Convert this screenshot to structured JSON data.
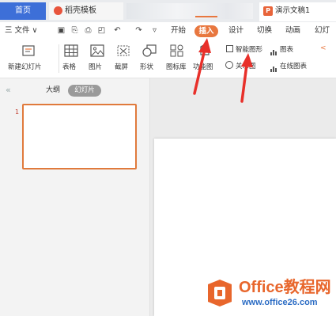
{
  "tabs": {
    "home": "首页",
    "template": "稻壳模板",
    "document": "演示文稿1"
  },
  "menu": {
    "file": "三 文件 ∨",
    "items": [
      "开始",
      "插入",
      "设计",
      "切换",
      "动画",
      "幻灯片"
    ]
  },
  "ribbon": {
    "new_slide": "新建幻灯片",
    "table": "表格",
    "image": "图片",
    "screenshot": "截屏",
    "shape": "形状",
    "icon_library": "图标库",
    "function_chart": "功能图",
    "smartart": "智能图形",
    "chart": "图表",
    "relation": "关系图",
    "online_chart": "在线图表"
  },
  "left_pane": {
    "outline_tab": "大纲",
    "slides_tab": "幻灯片",
    "slide_number": "1"
  },
  "watermark": {
    "title": "Office教程网",
    "url": "www.office26.com"
  },
  "colors": {
    "accent": "#e8773f",
    "home_tab": "#3d6fd8",
    "arrow": "#e8302a"
  }
}
